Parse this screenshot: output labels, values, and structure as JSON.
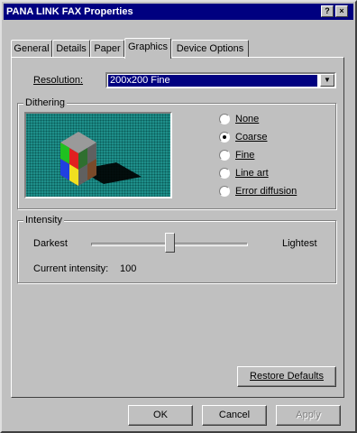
{
  "window": {
    "title": "PANA LINK FAX Properties",
    "help_glyph": "?",
    "close_glyph": "×"
  },
  "tabs": [
    {
      "label": "General",
      "active": false
    },
    {
      "label": "Details",
      "active": false
    },
    {
      "label": "Paper",
      "active": false
    },
    {
      "label": "Graphics",
      "active": true
    },
    {
      "label": "Device Options",
      "active": false
    }
  ],
  "resolution": {
    "label": "Resolution:",
    "value": "200x200 Fine"
  },
  "dithering": {
    "title": "Dithering",
    "options": [
      {
        "label": "None",
        "selected": false
      },
      {
        "label": "Coarse",
        "selected": true
      },
      {
        "label": "Fine",
        "selected": false
      },
      {
        "label": "Line art",
        "selected": false
      },
      {
        "label": "Error diffusion",
        "selected": false
      }
    ]
  },
  "intensity": {
    "title": "Intensity",
    "left_label": "Darkest",
    "right_label": "Lightest",
    "current_label": "Current intensity:",
    "current_value": "100",
    "level_fraction": 0.5
  },
  "buttons": {
    "restore_defaults": "Restore Defaults",
    "ok": "OK",
    "cancel": "Cancel",
    "apply": "Apply"
  },
  "colors": {
    "titlebar": "#000080",
    "preview_bg": "#1f8f8a",
    "selection": "#000080"
  }
}
